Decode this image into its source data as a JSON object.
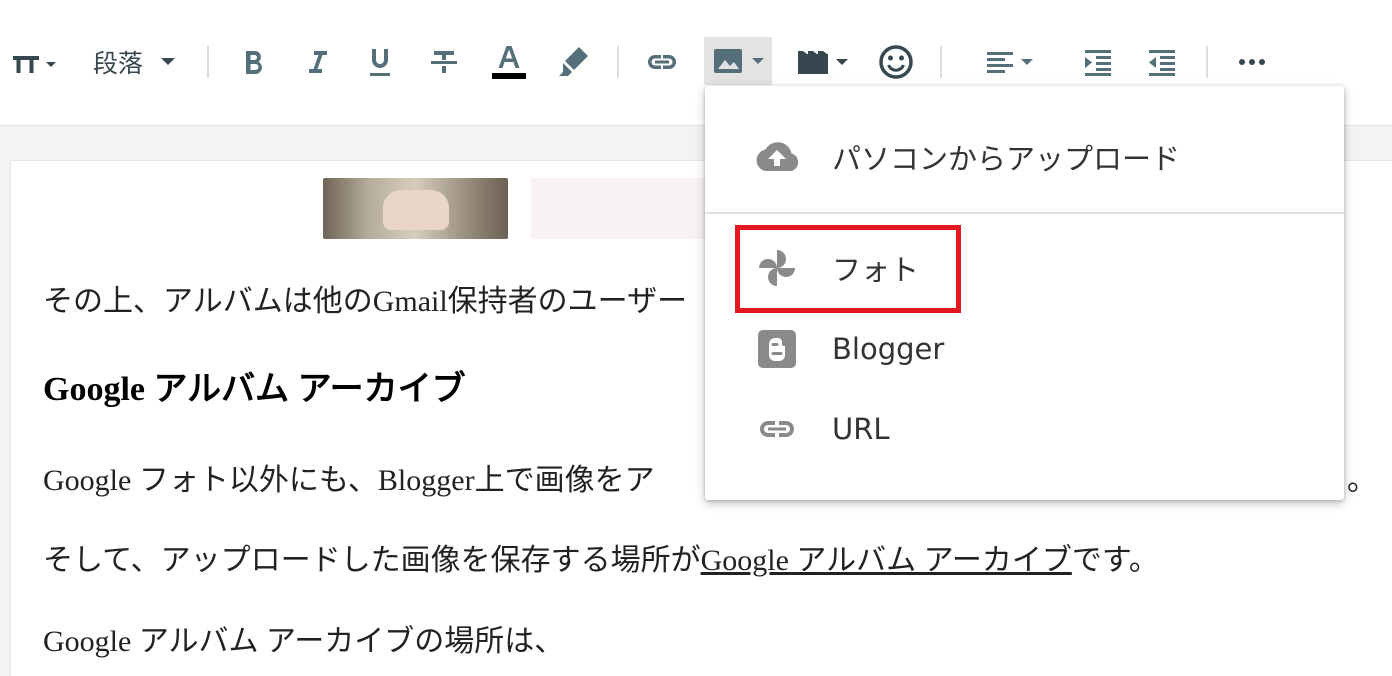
{
  "toolbar": {
    "font_size_icon": "font-size-icon",
    "format_label": "段落",
    "buttons": [
      "bold-icon",
      "italic-icon",
      "underline-icon",
      "strikethrough-icon",
      "text-color-icon",
      "highlight-icon",
      "link-icon",
      "image-icon",
      "video-icon",
      "emoji-icon",
      "align-icon",
      "indent-icon",
      "outdent-icon",
      "more-icon"
    ],
    "text_color_bar": "#000000",
    "icon_color": "#546e7a"
  },
  "editor": {
    "para1": "その上、アルバムは他のGmail保持者のユーザー",
    "heading": "Google アルバム アーカイブ",
    "para2": "Google フォト以外にも、Blogger上で画像をア",
    "para2_tail": "。",
    "para3_a": "そして、アップロードした画像を保存する場所が",
    "para3_link": "Google アルバム アーカイブ",
    "para3_b": "です。",
    "para4": "Google アルバム アーカイブの場所は、"
  },
  "image_menu": {
    "items": [
      {
        "label": "パソコンからアップロード",
        "icon": "cloud-upload-icon"
      },
      {
        "label": "フォト",
        "icon": "google-photos-icon"
      },
      {
        "label": "Blogger",
        "icon": "blogger-icon"
      },
      {
        "label": "URL",
        "icon": "link-icon"
      }
    ],
    "highlight_color": "#e3171f"
  }
}
